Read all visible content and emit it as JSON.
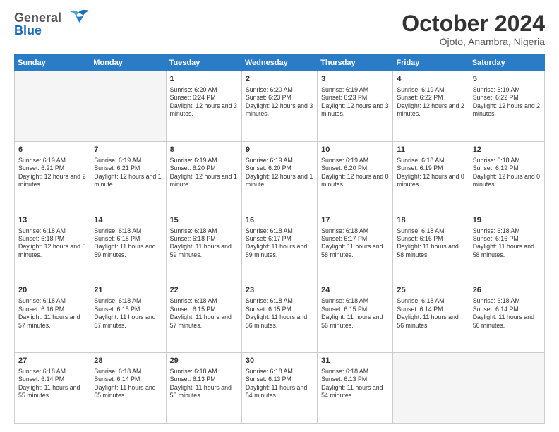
{
  "header": {
    "logo": {
      "general": "General",
      "blue": "Blue"
    },
    "title": "October 2024",
    "subtitle": "Ojoto, Anambra, Nigeria"
  },
  "calendar": {
    "days_of_week": [
      "Sunday",
      "Monday",
      "Tuesday",
      "Wednesday",
      "Thursday",
      "Friday",
      "Saturday"
    ],
    "weeks": [
      [
        {
          "day": "",
          "info": ""
        },
        {
          "day": "",
          "info": ""
        },
        {
          "day": "1",
          "info": "Sunrise: 6:20 AM\nSunset: 6:24 PM\nDaylight: 12 hours and 3 minutes."
        },
        {
          "day": "2",
          "info": "Sunrise: 6:20 AM\nSunset: 6:23 PM\nDaylight: 12 hours and 3 minutes."
        },
        {
          "day": "3",
          "info": "Sunrise: 6:19 AM\nSunset: 6:23 PM\nDaylight: 12 hours and 3 minutes."
        },
        {
          "day": "4",
          "info": "Sunrise: 6:19 AM\nSunset: 6:22 PM\nDaylight: 12 hours and 2 minutes."
        },
        {
          "day": "5",
          "info": "Sunrise: 6:19 AM\nSunset: 6:22 PM\nDaylight: 12 hours and 2 minutes."
        }
      ],
      [
        {
          "day": "6",
          "info": "Sunrise: 6:19 AM\nSunset: 6:21 PM\nDaylight: 12 hours and 2 minutes."
        },
        {
          "day": "7",
          "info": "Sunrise: 6:19 AM\nSunset: 6:21 PM\nDaylight: 12 hours and 1 minute."
        },
        {
          "day": "8",
          "info": "Sunrise: 6:19 AM\nSunset: 6:20 PM\nDaylight: 12 hours and 1 minute."
        },
        {
          "day": "9",
          "info": "Sunrise: 6:19 AM\nSunset: 6:20 PM\nDaylight: 12 hours and 1 minute."
        },
        {
          "day": "10",
          "info": "Sunrise: 6:19 AM\nSunset: 6:20 PM\nDaylight: 12 hours and 0 minutes."
        },
        {
          "day": "11",
          "info": "Sunrise: 6:18 AM\nSunset: 6:19 PM\nDaylight: 12 hours and 0 minutes."
        },
        {
          "day": "12",
          "info": "Sunrise: 6:18 AM\nSunset: 6:19 PM\nDaylight: 12 hours and 0 minutes."
        }
      ],
      [
        {
          "day": "13",
          "info": "Sunrise: 6:18 AM\nSunset: 6:18 PM\nDaylight: 12 hours and 0 minutes."
        },
        {
          "day": "14",
          "info": "Sunrise: 6:18 AM\nSunset: 6:18 PM\nDaylight: 11 hours and 59 minutes."
        },
        {
          "day": "15",
          "info": "Sunrise: 6:18 AM\nSunset: 6:18 PM\nDaylight: 11 hours and 59 minutes."
        },
        {
          "day": "16",
          "info": "Sunrise: 6:18 AM\nSunset: 6:17 PM\nDaylight: 11 hours and 59 minutes."
        },
        {
          "day": "17",
          "info": "Sunrise: 6:18 AM\nSunset: 6:17 PM\nDaylight: 11 hours and 58 minutes."
        },
        {
          "day": "18",
          "info": "Sunrise: 6:18 AM\nSunset: 6:16 PM\nDaylight: 11 hours and 58 minutes."
        },
        {
          "day": "19",
          "info": "Sunrise: 6:18 AM\nSunset: 6:16 PM\nDaylight: 11 hours and 58 minutes."
        }
      ],
      [
        {
          "day": "20",
          "info": "Sunrise: 6:18 AM\nSunset: 6:16 PM\nDaylight: 11 hours and 57 minutes."
        },
        {
          "day": "21",
          "info": "Sunrise: 6:18 AM\nSunset: 6:15 PM\nDaylight: 11 hours and 57 minutes."
        },
        {
          "day": "22",
          "info": "Sunrise: 6:18 AM\nSunset: 6:15 PM\nDaylight: 11 hours and 57 minutes."
        },
        {
          "day": "23",
          "info": "Sunrise: 6:18 AM\nSunset: 6:15 PM\nDaylight: 11 hours and 56 minutes."
        },
        {
          "day": "24",
          "info": "Sunrise: 6:18 AM\nSunset: 6:15 PM\nDaylight: 11 hours and 56 minutes."
        },
        {
          "day": "25",
          "info": "Sunrise: 6:18 AM\nSunset: 6:14 PM\nDaylight: 11 hours and 56 minutes."
        },
        {
          "day": "26",
          "info": "Sunrise: 6:18 AM\nSunset: 6:14 PM\nDaylight: 11 hours and 56 minutes."
        }
      ],
      [
        {
          "day": "27",
          "info": "Sunrise: 6:18 AM\nSunset: 6:14 PM\nDaylight: 11 hours and 55 minutes."
        },
        {
          "day": "28",
          "info": "Sunrise: 6:18 AM\nSunset: 6:14 PM\nDaylight: 11 hours and 55 minutes."
        },
        {
          "day": "29",
          "info": "Sunrise: 6:18 AM\nSunset: 6:13 PM\nDaylight: 11 hours and 55 minutes."
        },
        {
          "day": "30",
          "info": "Sunrise: 6:18 AM\nSunset: 6:13 PM\nDaylight: 11 hours and 54 minutes."
        },
        {
          "day": "31",
          "info": "Sunrise: 6:18 AM\nSunset: 6:13 PM\nDaylight: 11 hours and 54 minutes."
        },
        {
          "day": "",
          "info": ""
        },
        {
          "day": "",
          "info": ""
        }
      ]
    ]
  }
}
